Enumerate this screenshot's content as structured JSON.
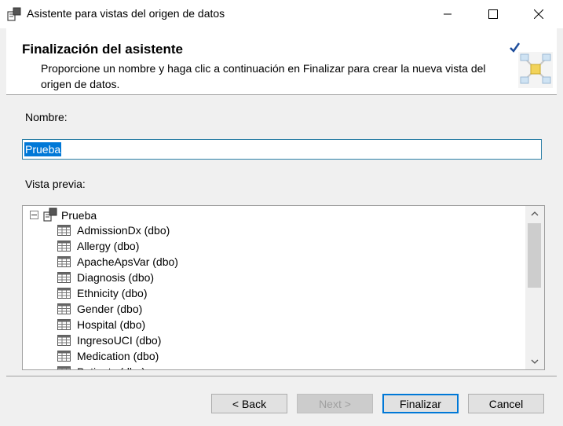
{
  "window": {
    "title": "Asistente para vistas del origen de datos"
  },
  "header": {
    "title": "Finalización del asistente",
    "description": "Proporcione un nombre y haga clic a continuación en Finalizar para crear la nueva vista del origen de datos."
  },
  "form": {
    "name_label": "Nombre:",
    "name_value": "Prueba",
    "preview_label": "Vista previa:"
  },
  "tree": {
    "root_label": "Prueba",
    "items": [
      "AdmissionDx (dbo)",
      "Allergy (dbo)",
      "ApacheApsVar (dbo)",
      "Diagnosis (dbo)",
      "Ethnicity (dbo)",
      "Gender (dbo)",
      "Hospital (dbo)",
      "IngresoUCI (dbo)",
      "Medication (dbo)",
      "Patients (dbo)"
    ]
  },
  "buttons": {
    "back": "< Back",
    "next": "Next >",
    "finish": "Finalizar",
    "cancel": "Cancel"
  },
  "colors": {
    "selection": "#0078d7",
    "input_border": "#2c7fa6"
  }
}
